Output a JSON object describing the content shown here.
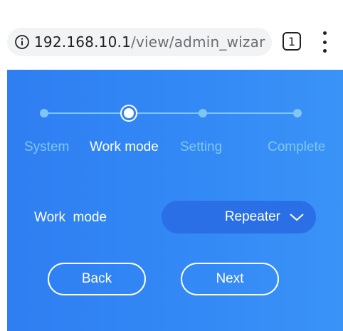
{
  "browser": {
    "url_host": "192.168.10.1",
    "url_path": "/view/admin_wizar",
    "tab_count": "1",
    "icons": {
      "info": "info-circle-icon",
      "menu": "vertical-dots-icon"
    }
  },
  "wizard": {
    "steps": [
      {
        "label": "System",
        "state": "done"
      },
      {
        "label": "Work mode",
        "state": "current"
      },
      {
        "label": "Setting",
        "state": "pending"
      },
      {
        "label": "Complete",
        "state": "pending"
      }
    ],
    "current_step_index": 1,
    "work_mode": {
      "label": "Work  mode",
      "selected": "Repeater",
      "icon": "chevron-down-icon"
    },
    "buttons": {
      "back": "Back",
      "next": "Next"
    }
  },
  "colors": {
    "panel_start": "#2f7ef2",
    "panel_end": "#3a93f7",
    "step_line": "#7fc6f4",
    "step_inactive_text": "#7fc6f4",
    "select_bg": "#2a6fe6",
    "white": "#ffffff"
  }
}
